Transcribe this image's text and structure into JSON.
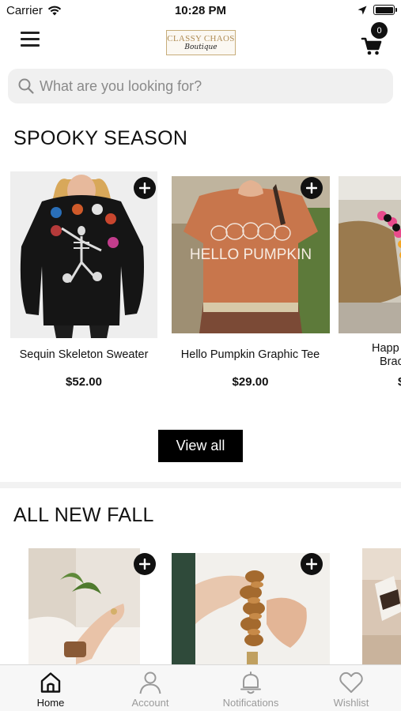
{
  "status_bar": {
    "carrier": "Carrier",
    "time": "10:28 PM"
  },
  "header": {
    "logo_main": "CLASSY CHAOS",
    "logo_sub": "Boutique",
    "cart_count": "0"
  },
  "search": {
    "placeholder": "What are you looking for?"
  },
  "sections": [
    {
      "title": "SPOOKY SEASON",
      "products": [
        {
          "name": "Sequin Skeleton Sweater",
          "price": "$52.00"
        },
        {
          "name": "Hello Pumpkin Graphic Tee",
          "price": "$29.00"
        },
        {
          "name_line1": "Happ",
          "name_line2": "Brac",
          "price": "$"
        }
      ],
      "view_all_label": "View all"
    },
    {
      "title": "ALL NEW FALL"
    }
  ],
  "tee_print": "HELLO PUMPKIN",
  "tabs": [
    {
      "label": "Home",
      "icon": "home-icon",
      "active": true
    },
    {
      "label": "Account",
      "icon": "account-icon"
    },
    {
      "label": "Notifications",
      "icon": "bell-icon"
    },
    {
      "label": "Wishlist",
      "icon": "heart-icon"
    }
  ],
  "colors": {
    "accent": "#111111",
    "tab_inactive": "#9a9a9a",
    "logo_gold": "#b08d55",
    "tee_orange": "#c8764c"
  }
}
